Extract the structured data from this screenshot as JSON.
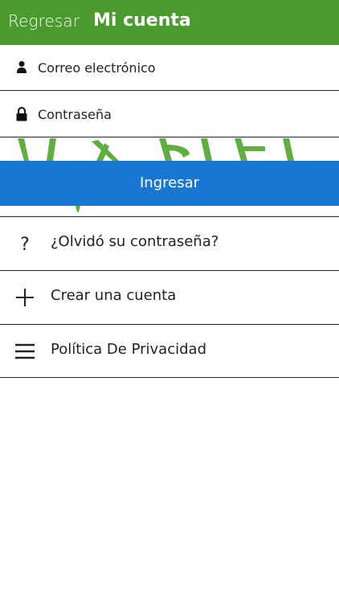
{
  "header": {
    "back_label": "Regresar",
    "title": "Mi cuenta",
    "background": "#4a9a2f"
  },
  "form": {
    "email": {
      "placeholder": "Correo electrónico",
      "value": "",
      "icon": "user-icon"
    },
    "password": {
      "placeholder": "Contraseña",
      "value": "",
      "icon": "lock-icon"
    },
    "submit_label": "Ingresar",
    "submit_color": "#1976d2"
  },
  "menu": {
    "items": [
      {
        "label": "¿Olvidó su contraseña?",
        "icon": "question-icon"
      },
      {
        "label": "Crear una cuenta",
        "icon": "plus-icon"
      },
      {
        "label": "Política De Privacidad",
        "icon": "menu-icon"
      }
    ]
  }
}
